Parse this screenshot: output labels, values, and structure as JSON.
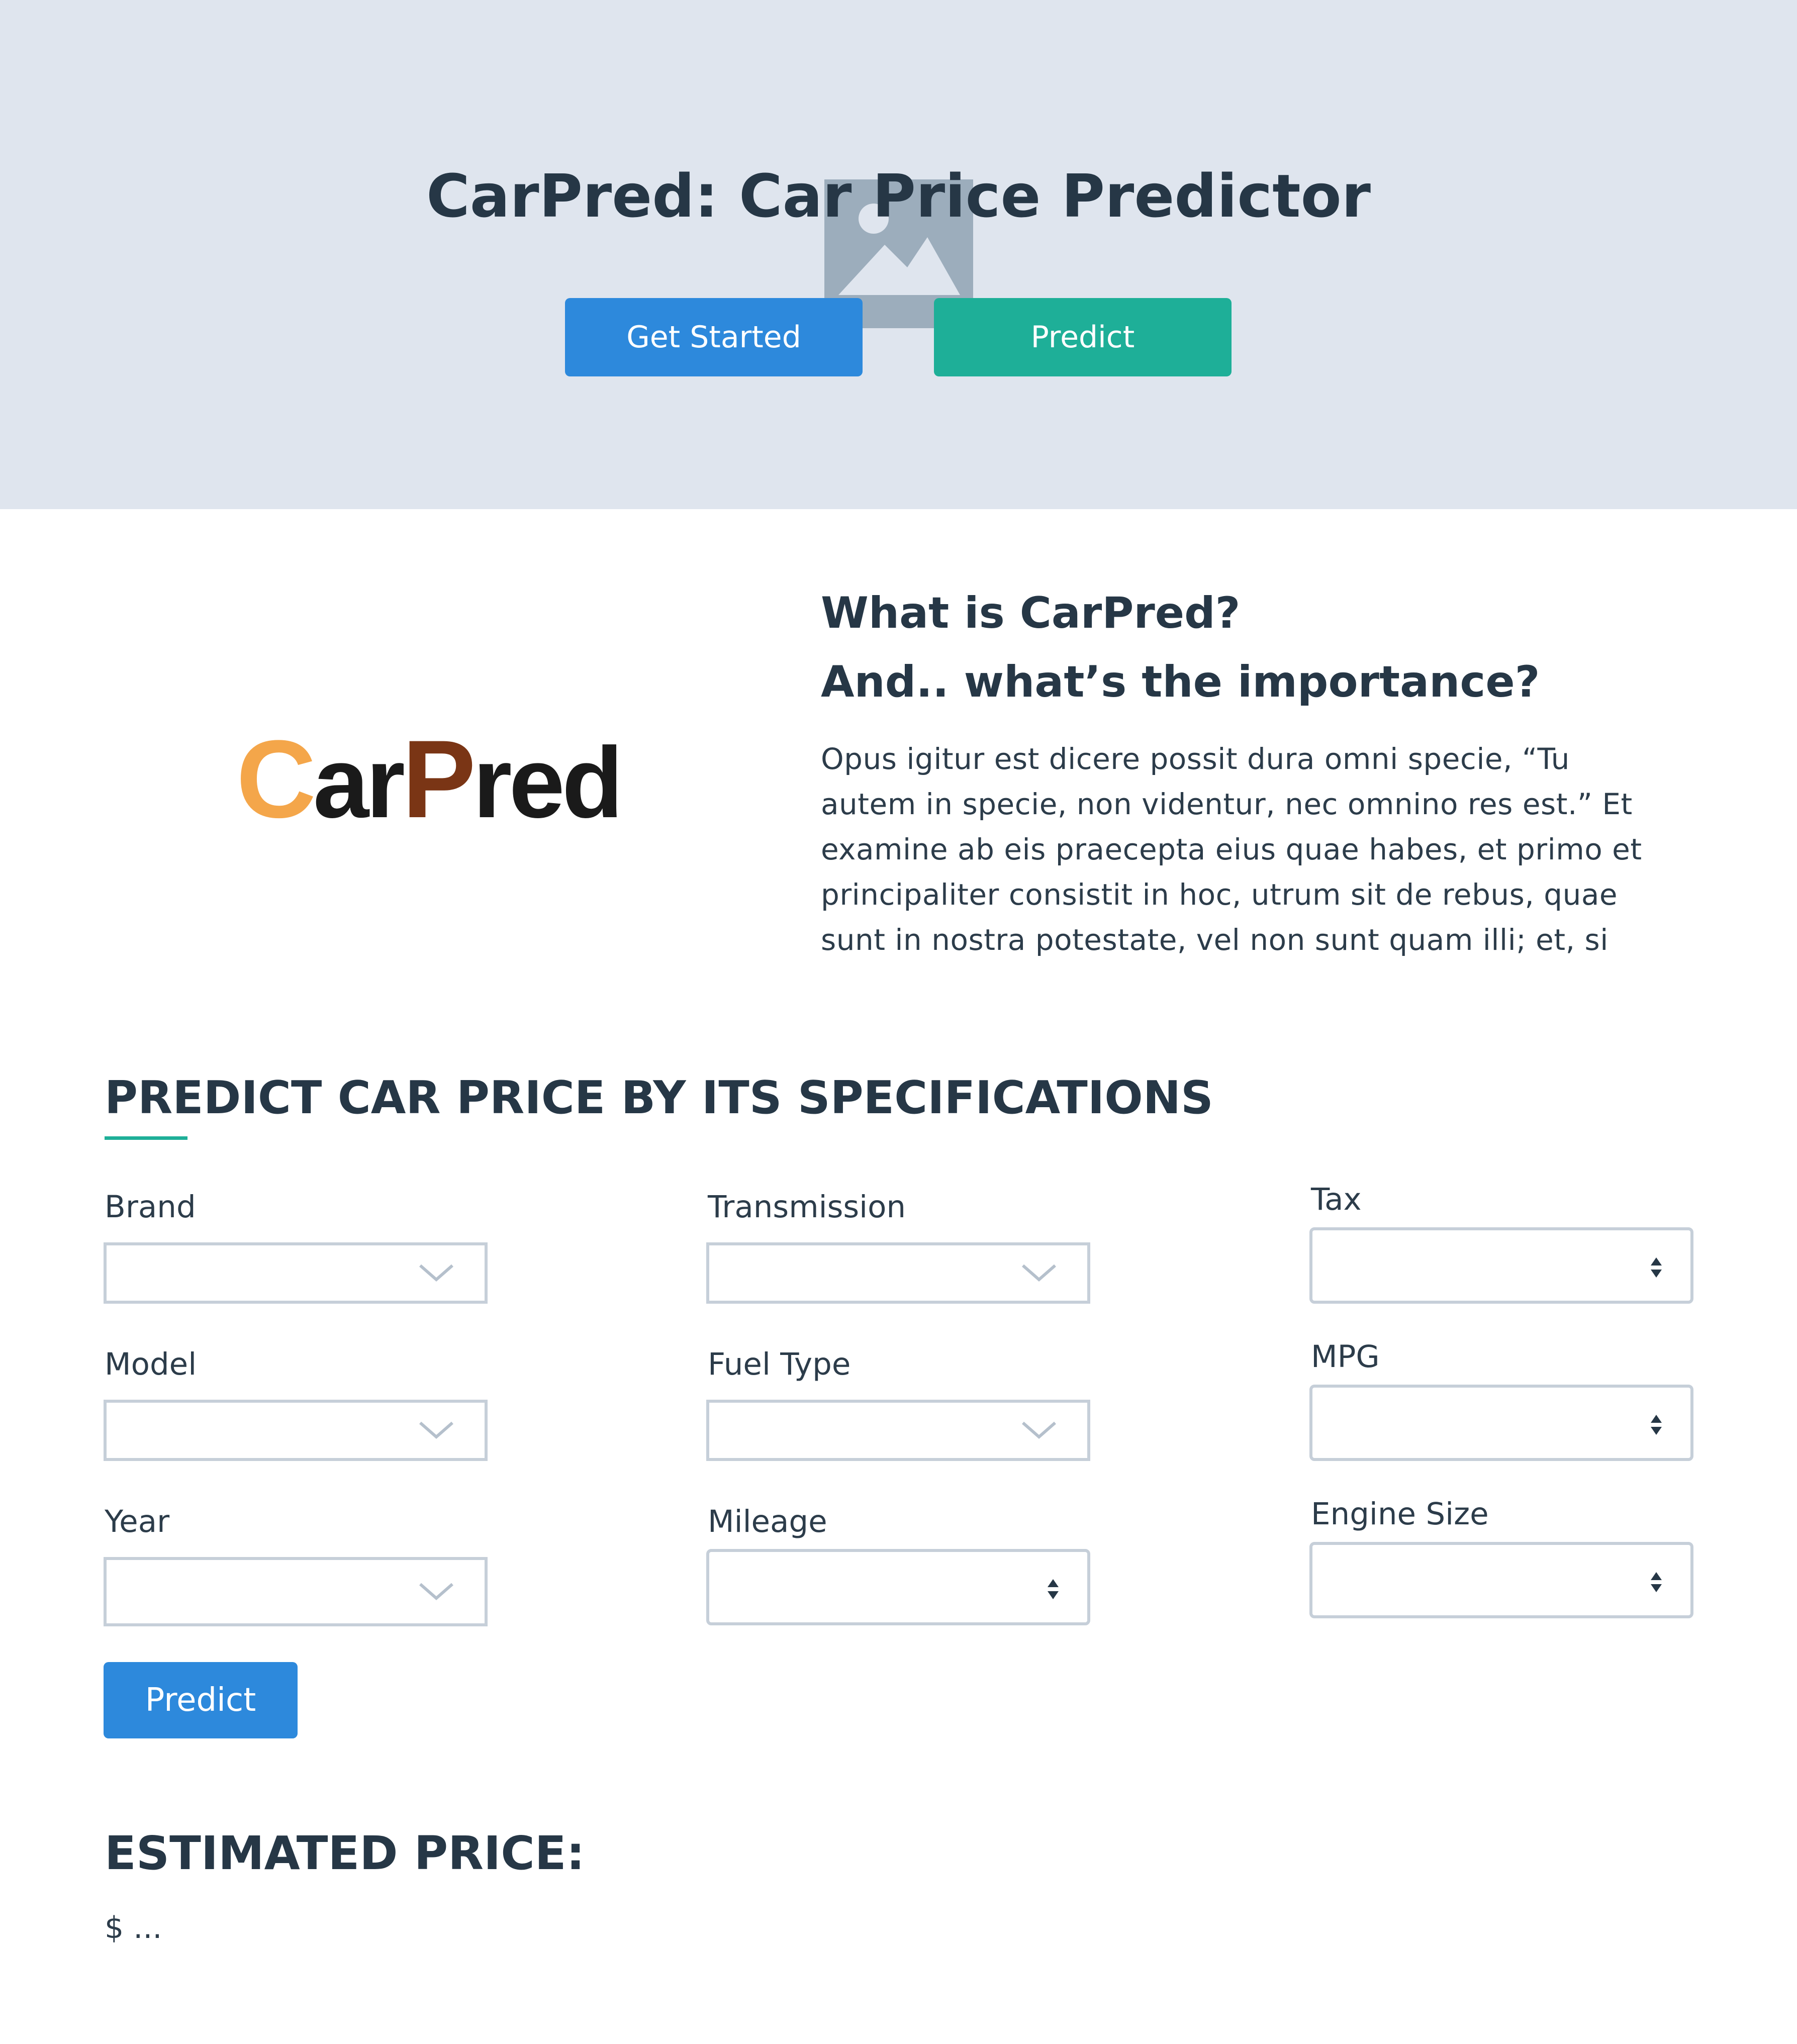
{
  "hero": {
    "title": "CarPred: Car Price Predictor",
    "buttons": {
      "get_started": "Get Started",
      "predict": "Predict"
    },
    "image_placeholder_icon": "image-icon"
  },
  "logo": {
    "c": "C",
    "ar": "ar",
    "p": "P",
    "red": "red"
  },
  "about": {
    "question_1": "What is CarPred?",
    "question_2": "And.. what’s the importance?",
    "body": "Opus igitur est dicere possit dura omni specie, “Tu autem in specie, non videntur, nec omnino res est.” Et examine ab eis praecepta eius quae habes, et primo et principaliter consistit in hoc, utrum sit de rebus, quae sunt in nostra potestate, vel non sunt quam illi; et, si"
  },
  "predict_form": {
    "heading": "PREDICT CAR PRICE BY ITS SPECIFICATIONS",
    "fields": {
      "brand": {
        "label": "Brand",
        "value": ""
      },
      "model": {
        "label": "Model",
        "value": ""
      },
      "year": {
        "label": "Year",
        "value": ""
      },
      "transmission": {
        "label": "Transmission",
        "value": ""
      },
      "fuel_type": {
        "label": "Fuel Type",
        "value": ""
      },
      "mileage": {
        "label": "Mileage",
        "value": ""
      },
      "tax": {
        "label": "Tax",
        "value": ""
      },
      "mpg": {
        "label": "MPG",
        "value": ""
      },
      "engine_size": {
        "label": "Engine Size",
        "value": ""
      }
    },
    "predict_button": "Predict"
  },
  "estimate": {
    "heading": "ESTIMATED PRICE:",
    "value": "$ ..."
  },
  "colors": {
    "hero_bg": "#dfe5ee",
    "primary_blue": "#2d89dc",
    "teal": "#1eaf98",
    "text_dark": "#263746",
    "logo_orange": "#f4a64a",
    "logo_brown": "#7a3515",
    "field_border": "#c6cfd9"
  }
}
